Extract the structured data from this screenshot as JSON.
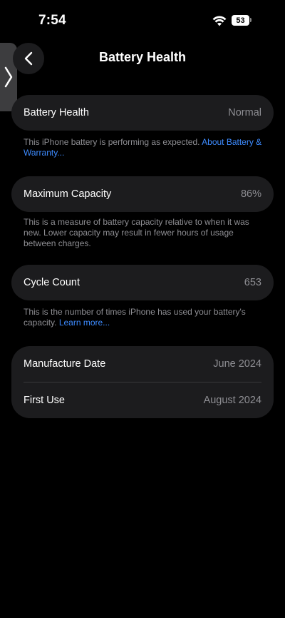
{
  "status_bar": {
    "time": "7:54",
    "battery_percent": "53"
  },
  "header": {
    "title": "Battery Health"
  },
  "battery_health": {
    "label": "Battery Health",
    "value": "Normal",
    "footnote": "This iPhone battery is performing as expected. ",
    "footnote_link": "About Battery & Warranty..."
  },
  "maximum_capacity": {
    "label": "Maximum Capacity",
    "value": "86%",
    "footnote": "This is a measure of battery capacity relative to when it was new. Lower capacity may result in fewer hours of usage between charges."
  },
  "cycle_count": {
    "label": "Cycle Count",
    "value": "653",
    "footnote": "This is the number of times iPhone has used your battery's capacity. ",
    "footnote_link": "Learn more..."
  },
  "dates": {
    "manufacture_label": "Manufacture Date",
    "manufacture_value": "June 2024",
    "first_use_label": "First Use",
    "first_use_value": "August 2024"
  },
  "colors": {
    "background": "#000000",
    "card": "#1c1c1e",
    "link": "#3d8bff",
    "secondary_text": "#8e8e93"
  }
}
